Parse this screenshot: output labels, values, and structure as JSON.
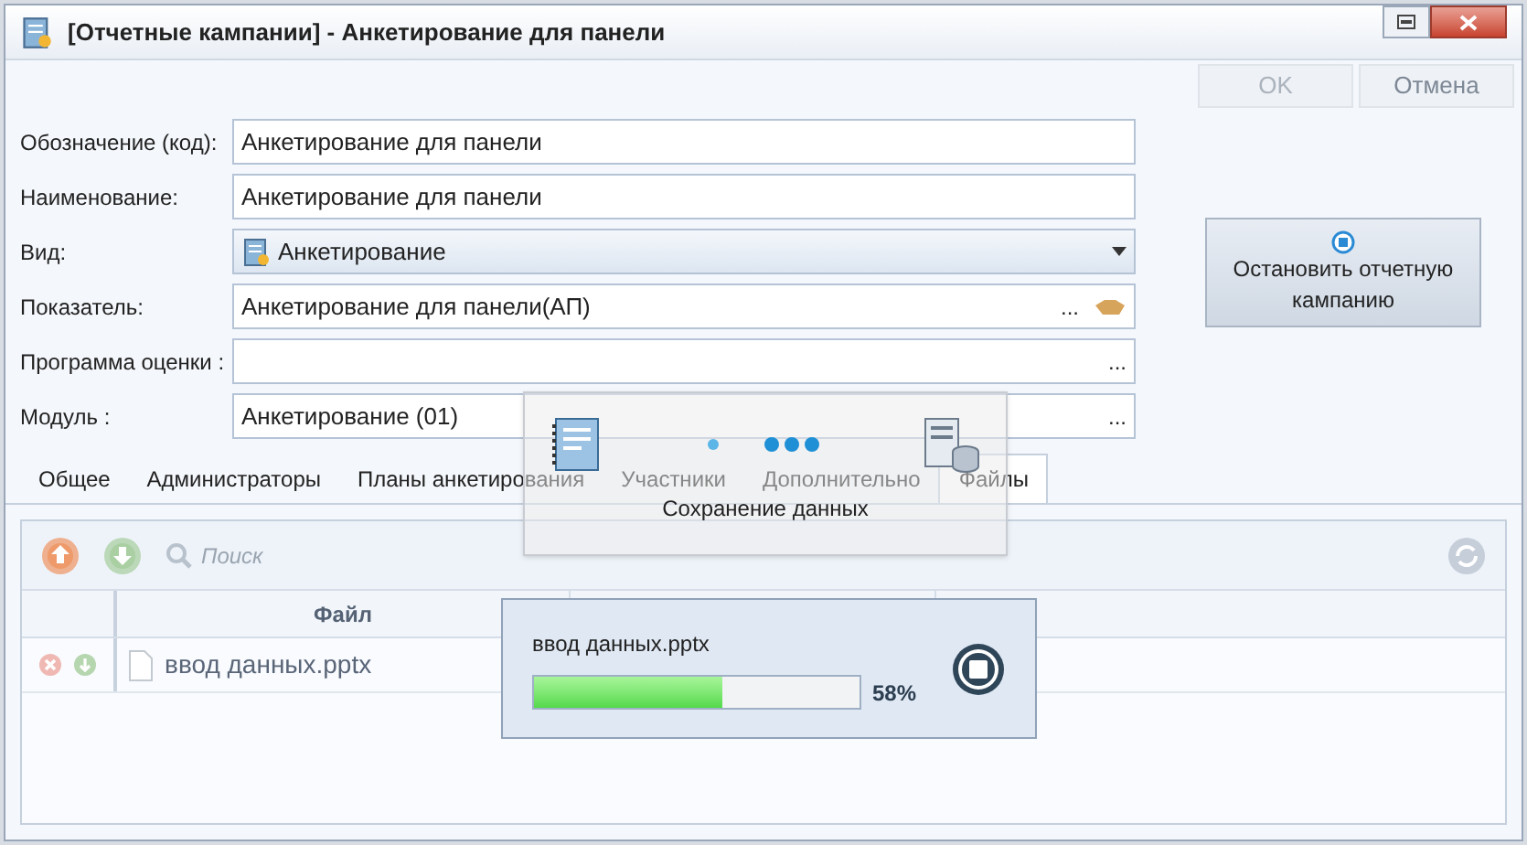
{
  "window": {
    "title": "[Отчетные кампании] - Анкетирование для панели"
  },
  "buttons": [
    {
      "label": "OK",
      "disabled": true
    },
    {
      "label": "Отмена",
      "disabled": false
    }
  ],
  "fields": [
    {
      "label": "Обозначение (код):",
      "value": "Анкетирование для панели",
      "kind": "text"
    },
    {
      "label": "Наименование:",
      "value": "Анкетирование для панели",
      "kind": "text"
    },
    {
      "label": "Вид:",
      "value": "Анкетирование",
      "kind": "select"
    },
    {
      "label": "Показатель:",
      "value": "Анкетирование для панели(АП)",
      "kind": "picker",
      "picker": "...",
      "linked": true
    },
    {
      "label": "Программа оценки :",
      "kind": "picker",
      "picker": "...",
      "linked": false
    },
    {
      "label": "Модуль :",
      "value": "Анкетирование (01)",
      "kind": "picker",
      "picker": "...",
      "linked": false
    }
  ],
  "stop_button": {
    "label": "Остановить отчетную кампанию"
  },
  "tabs": [
    {
      "label": "Общее",
      "selected": false
    },
    {
      "label": "Администраторы",
      "selected": false
    },
    {
      "label": "Планы анкетирования",
      "selected": false
    },
    {
      "label": "Участники",
      "selected": false
    },
    {
      "label": "Дополнительно",
      "selected": false
    },
    {
      "label": "Файлы",
      "selected": true
    }
  ],
  "toolbar": {
    "search_placeholder": "Поиск"
  },
  "table": {
    "columns": [
      {
        "title": "Файл"
      }
    ],
    "rows": [
      {
        "file": "ввод данных.pptx"
      }
    ]
  },
  "saving_dialog": {
    "message": "Сохранение данных"
  },
  "upload_popup": {
    "file": "ввод данных.pptx",
    "level": 0.58,
    "reading": "58%"
  }
}
